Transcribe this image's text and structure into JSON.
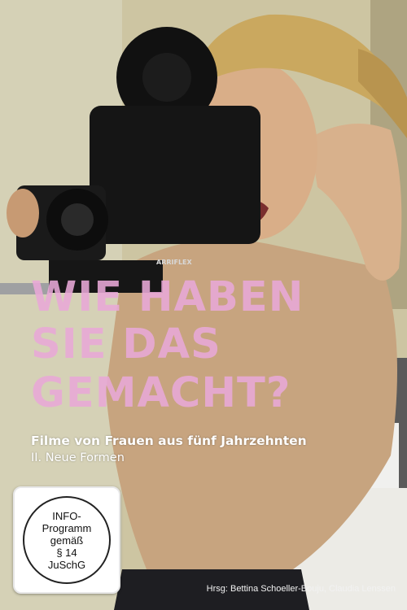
{
  "cover": {
    "title_lines": [
      "WIE HABEN",
      "SIE DAS",
      "GEMACHT?"
    ],
    "subtitle": "Filme von Frauen aus fünf Jahrzehnten",
    "part": "II. Neue Formen",
    "camera_brand": "ARRIFLEX",
    "credits": "Hrsg: Bettina Schoeller-Bouju, Claudia Lenssen",
    "rating_badge": {
      "lines": [
        "INFO-",
        "Programm",
        "gemäß",
        "§ 14",
        "JuSchG"
      ]
    },
    "colors": {
      "title": "#e9a9d8",
      "text": "#ffffff",
      "background": "#cfc7a3"
    }
  }
}
